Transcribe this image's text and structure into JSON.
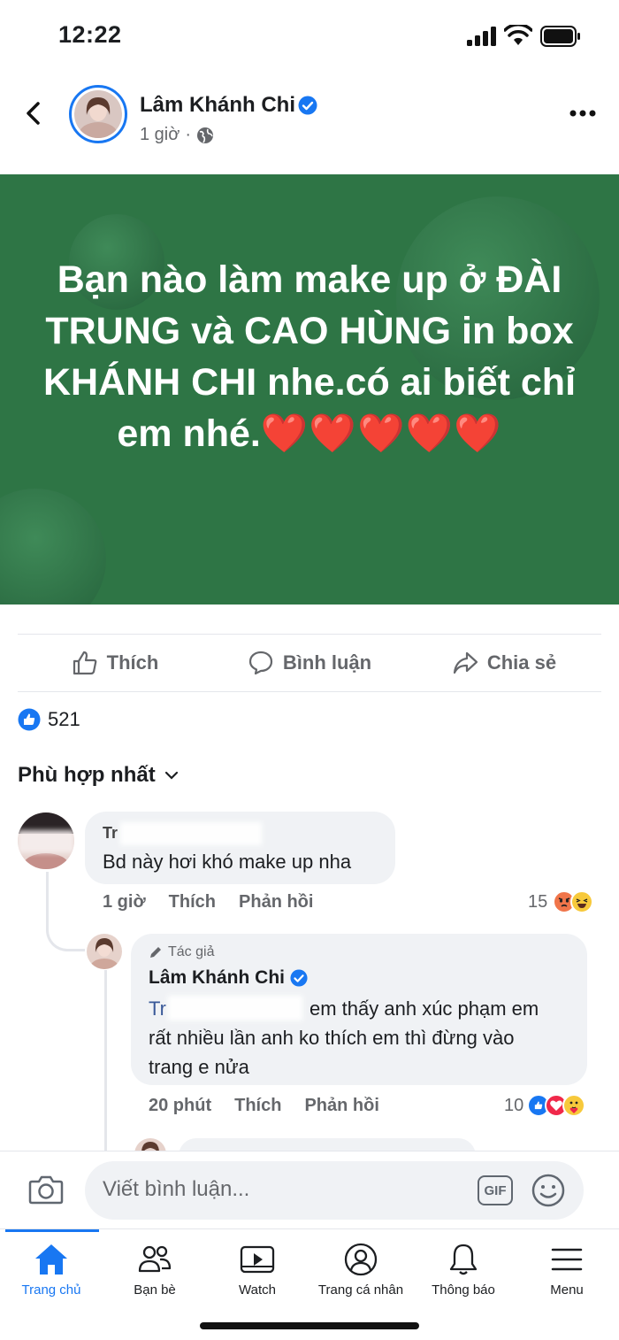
{
  "status_bar": {
    "time": "12:22"
  },
  "post": {
    "author": "Lâm Khánh Chi",
    "time": "1 giờ",
    "separator": "·",
    "text": "Bạn nào làm make up ở ĐÀI TRUNG và CAO HÙNG in box KHÁNH CHI nhe.có ai biết chỉ em nhé.",
    "hearts": "❤️❤️❤️❤️❤️",
    "background_color": "#2e7545"
  },
  "actions": {
    "like": "Thích",
    "comment": "Bình luận",
    "share": "Chia sẻ"
  },
  "reactions": {
    "count": "521"
  },
  "sort": {
    "label": "Phù hợp nhất"
  },
  "comments": [
    {
      "name_partial": "Tr",
      "text": "Bd này hơi khó make up nha",
      "time": "1 giờ",
      "like": "Thích",
      "reply": "Phản hồi",
      "reaction_count": "15"
    }
  ],
  "reply": {
    "author_tag": "Tác giả",
    "author": "Lâm Khánh Chi",
    "mention_partial": "Tr",
    "text": "em thấy anh xúc phạm em",
    "text_lines": [
      "rất nhiều lần anh ko thích em thì đừng vào",
      "trang e nửa"
    ],
    "time": "20 phút",
    "like": "Thích",
    "reply": "Phản hồi",
    "reaction_count": "10"
  },
  "composer": {
    "placeholder": "Viết bình luận...",
    "gif": "GIF"
  },
  "tabs": [
    {
      "label": "Trang chủ",
      "icon": "home-icon"
    },
    {
      "label": "Bạn bè",
      "icon": "friends-icon"
    },
    {
      "label": "Watch",
      "icon": "watch-icon"
    },
    {
      "label": "Trang cá nhân",
      "icon": "profile-icon"
    },
    {
      "label": "Thông báo",
      "icon": "bell-icon"
    },
    {
      "label": "Menu",
      "icon": "menu-icon"
    }
  ],
  "colors": {
    "brand": "#1877f2",
    "muted": "#65676b"
  }
}
